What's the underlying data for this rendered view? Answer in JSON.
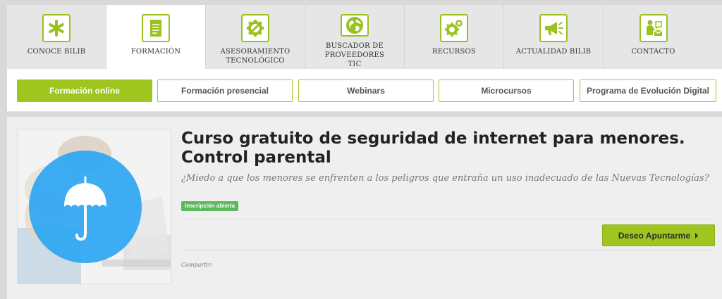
{
  "topnav": {
    "items": [
      {
        "label": "CONOCE BILIB",
        "icon": "asterisk-icon"
      },
      {
        "label": "FORMACIÓN",
        "icon": "document-icon",
        "active": true
      },
      {
        "label": "ASESORAMIENTO TECNOLÓGICO",
        "icon": "wrench-gear-icon"
      },
      {
        "label": "BUSCADOR DE PROVEEDORES TIC",
        "icon": "globe-icon"
      },
      {
        "label": "RECURSOS",
        "icon": "gears-icon"
      },
      {
        "label": "ACTUALIDAD BILIB",
        "icon": "megaphone-icon"
      },
      {
        "label": "CONTACTO",
        "icon": "contact-person-icon"
      }
    ]
  },
  "subnav": {
    "tabs": [
      {
        "label": "Formación online",
        "active": true
      },
      {
        "label": "Formación presencial"
      },
      {
        "label": "Webinars"
      },
      {
        "label": "Microcursos"
      },
      {
        "label": "Programa de Evolución Digital"
      }
    ]
  },
  "course": {
    "title": "Curso gratuito de seguridad de internet para menores. Control parental",
    "subtitle": "¿Miedo a que los menores se enfrenten a los peligros que entraña un uso inadecuado de las Nuevas Tecnologías?",
    "badge": "Inscripción abierta",
    "apply_label": "Deseo Apuntarme",
    "share_label": "Compartir:",
    "image_icon": "umbrella-icon"
  },
  "colors": {
    "accent": "#9fc51f",
    "badge": "#5cb85c",
    "umbrella_circle": "#2ea6f2"
  }
}
